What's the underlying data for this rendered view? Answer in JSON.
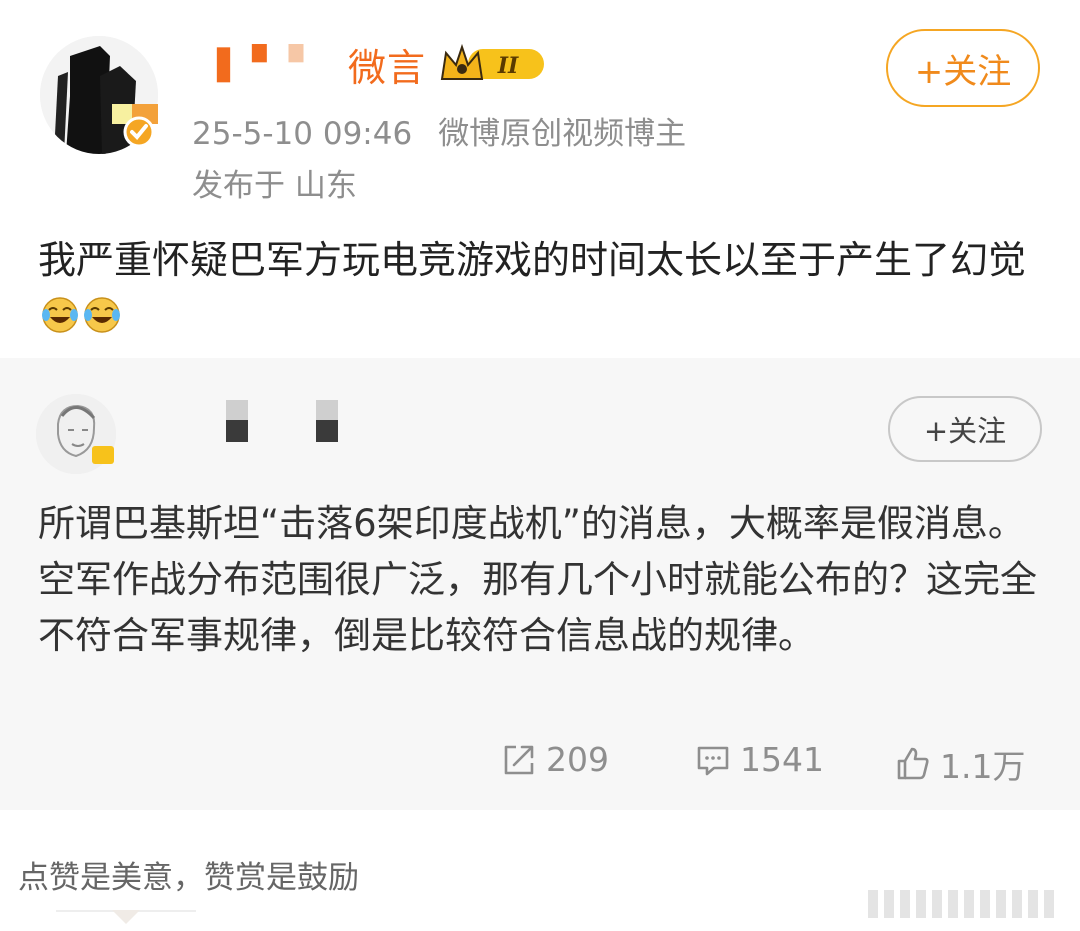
{
  "post": {
    "username_visible": "ㄒ微言",
    "timestamp": "25-5-10 09:46",
    "author_tag": "微博原创视频博主",
    "location": "发布于 山东",
    "follow_label": "+关注",
    "text": "我严重怀疑巴军方玩电竞游戏的时间太长以至于产生了幻觉",
    "emoji": "laughing-tears-emoji",
    "rank_badge": "II"
  },
  "repost": {
    "follow_label": "+关注",
    "text": "所谓巴基斯坦“击落6架印度战机”的消息，大概率是假消息。空军作战分布范围很广泛，那有几个小时就能公布的？这完全不符合军事规律，倒是比较符合信息战的规律。",
    "shares": "209",
    "comments": "1541",
    "likes": "1.1万"
  },
  "footer": {
    "reward_text": "点赞是美意，赞赏是鼓励"
  },
  "colors": {
    "accent_orange": "#f26b1d",
    "follow_border": "#f5a623",
    "meta_gray": "#8e8e8e",
    "repost_bg": "#f7f7f7"
  }
}
